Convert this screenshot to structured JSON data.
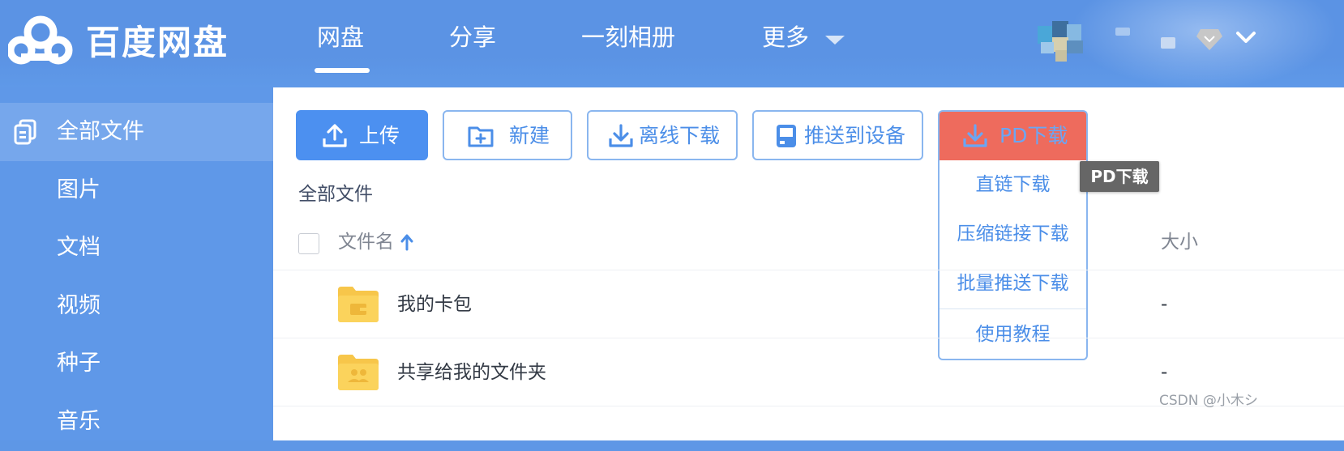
{
  "header": {
    "logo_text": "百度网盘",
    "nav": [
      {
        "label": "网盘"
      },
      {
        "label": "分享"
      },
      {
        "label": "一刻相册"
      },
      {
        "label": "更多"
      }
    ]
  },
  "sidebar": {
    "items": [
      {
        "label": "全部文件"
      },
      {
        "label": "图片"
      },
      {
        "label": "文档"
      },
      {
        "label": "视频"
      },
      {
        "label": "种子"
      },
      {
        "label": "音乐"
      }
    ]
  },
  "toolbar": {
    "upload": "上传",
    "new": "新建",
    "offline": "离线下载",
    "push": "推送到设备",
    "pd": "PD下载"
  },
  "pd_menu": {
    "items": [
      "直链下载",
      "压缩链接下载",
      "批量推送下载",
      "使用教程"
    ],
    "tooltip": "PD下载"
  },
  "main": {
    "breadcrumb": "全部文件",
    "columns": {
      "name": "文件名",
      "size": "大小"
    },
    "rows": [
      {
        "name": "我的卡包",
        "size": "-"
      },
      {
        "name": "共享给我的文件夹",
        "size": "-"
      }
    ]
  },
  "colors": {
    "accent": "#4c90f0",
    "pd_button": "#ee6b5d",
    "sidebar": "#5f98e8"
  },
  "watermark": "CSDN @小木シ"
}
